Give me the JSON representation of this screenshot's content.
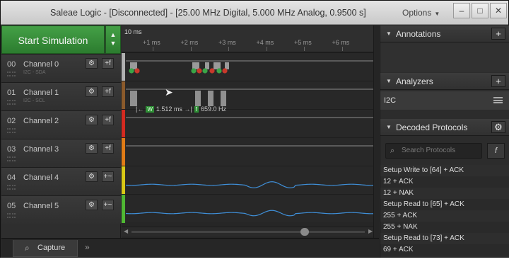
{
  "window": {
    "title": "Saleae Logic - [Disconnected] - [25.00 MHz Digital, 5.000 MHz Analog, 0.9500 s]",
    "options_label": "Options",
    "minimize": "–",
    "maximize": "□",
    "close": "✕"
  },
  "simulation": {
    "start_label": "Start Simulation",
    "up_arrow": "▲",
    "down_arrow": "▼"
  },
  "channels": [
    {
      "num": "00",
      "name": "Channel 0",
      "sub": "I2C - SDA",
      "color": "#b0b0b0"
    },
    {
      "num": "01",
      "name": "Channel 1",
      "sub": "I2C - SCL",
      "color": "#8b5a2b"
    },
    {
      "num": "02",
      "name": "Channel 2",
      "sub": "",
      "color": "#d42a20"
    },
    {
      "num": "03",
      "name": "Channel 3",
      "sub": "",
      "color": "#e07b16"
    },
    {
      "num": "04",
      "name": "Channel 4",
      "sub": "",
      "color": "#d8c815"
    },
    {
      "num": "05",
      "name": "Channel 5",
      "sub": "",
      "color": "#4fb833"
    }
  ],
  "icons": {
    "gear": "⚙",
    "trigger": "+f",
    "trigger_analog": "+~"
  },
  "ruler": {
    "base": "10 ms",
    "ticks": [
      "+1 ms",
      "+2 ms",
      "+3 ms",
      "+4 ms",
      "+5 ms",
      "+6 ms"
    ]
  },
  "measure": {
    "width_tag": "W",
    "width_value": "1.512 ms",
    "freq_tag": "f",
    "freq_value": "659.0 Hz"
  },
  "bottom": {
    "capture_label": "Capture",
    "more": "»"
  },
  "annotations": {
    "title": "Annotations",
    "add": "+"
  },
  "analyzers": {
    "title": "Analyzers",
    "add": "+",
    "items": [
      "I2C"
    ]
  },
  "decoded": {
    "title": "Decoded Protocols",
    "search_placeholder": "Search Protocols",
    "filter": "f",
    "items": [
      "Setup Write to [64] + ACK",
      "12 + ACK",
      "12 + NAK",
      "Setup Read to [65] + ACK",
      "255 + ACK",
      "255 + NAK",
      "Setup Read to [73] + ACK",
      "69 + ACK"
    ]
  },
  "colors": {
    "accent_green": "#2f8f36",
    "marker_red": "#c8392b",
    "marker_green": "#3aa547",
    "analog_wave": "#3f8fd8"
  }
}
